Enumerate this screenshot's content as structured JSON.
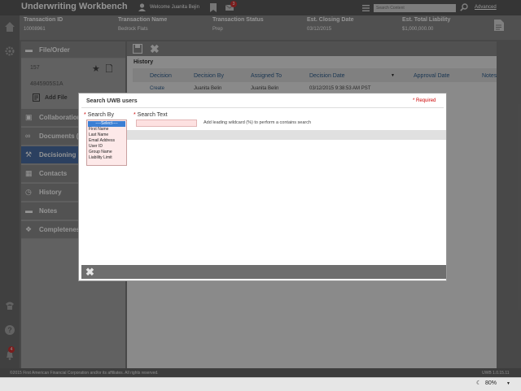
{
  "header": {
    "app_title": "Underwriting Workbench",
    "welcome": "Welcome Juanita Bejin",
    "message_badge": "3",
    "search_placeholder": "Search Content",
    "advanced_label": "Advanced"
  },
  "transaction": {
    "columns": [
      {
        "label": "Transaction ID",
        "value": "10008961"
      },
      {
        "label": "Transaction Name",
        "value": "Bedrock Flats"
      },
      {
        "label": "Transaction Status",
        "value": "Prep"
      },
      {
        "label": "Est. Closing Date",
        "value": "03/12/2015"
      },
      {
        "label": "Est. Total Liability",
        "value": "$1,000,000.00"
      }
    ]
  },
  "sidebar": {
    "file_order": {
      "label": "File/Order",
      "file_number": "157",
      "file_code": "4845905S1A",
      "add_file_label": "Add File"
    },
    "items": [
      {
        "label": "Collaboration",
        "icon": "chat-icon"
      },
      {
        "label": "Documents (",
        "icon": "paperclip-icon"
      },
      {
        "label": "Decisioning",
        "icon": "gavel-icon"
      },
      {
        "label": "Contacts",
        "icon": "contact-card-icon"
      },
      {
        "label": "History",
        "icon": "clock-icon"
      },
      {
        "label": "Notes",
        "icon": "folder-icon"
      },
      {
        "label": "Completeness",
        "icon": "puzzle-icon"
      }
    ],
    "alerts_badge": "4"
  },
  "history": {
    "title": "History",
    "columns": [
      "Decision",
      "Decision By",
      "Assigned To",
      "Decision Date",
      "Approval Date",
      "Notes"
    ],
    "rows": [
      [
        "Create",
        "Juanita Belin",
        "Juanita Belin",
        "03/12/2015 9:38:53 AM PST",
        "",
        ""
      ]
    ]
  },
  "modal": {
    "title": "Search UWB users",
    "required_label": "Required",
    "search_by_label": "Search By",
    "search_text_label": "Search Text",
    "hint": "Add leading wildcard (%) to perform a contains search",
    "search_by_options": [
      "----Select----",
      "First Name",
      "Last Name",
      "Email Address",
      "User ID",
      "Group Name",
      "Liability Limit"
    ],
    "search_by_selected": "----Select----"
  },
  "footer": {
    "copyright": "©2015 First American Financial Corporation and/or its affiliates. All rights reserved.",
    "version": "UWB 1.0.15.11"
  },
  "statusbar": {
    "zoom": "80%"
  },
  "colors": {
    "header_bg": "#5c5c5c",
    "sidebar_selected": "#4a6fa5",
    "select_highlight": "#3b7fd4",
    "required_red": "#cc0000",
    "badge_red": "#d33333"
  }
}
